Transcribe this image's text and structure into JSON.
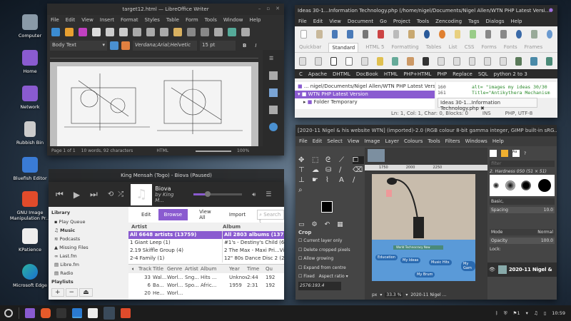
{
  "desktop": {
    "icons": [
      {
        "label": "Computer",
        "icon": "computer-icon",
        "color": "#9aa"
      },
      {
        "label": "Home",
        "icon": "home-folder-icon",
        "color": "#8a5bd0"
      },
      {
        "label": "Network",
        "icon": "network-folder-icon",
        "color": "#8a5bd0"
      },
      {
        "label": "Rubbish Bin",
        "icon": "trash-icon",
        "color": "#ccc"
      },
      {
        "label": "Bluefish Editor",
        "icon": "bluefish-icon",
        "color": "#3a7bd5"
      },
      {
        "label": "GNU Image Manipulation Pr...",
        "icon": "gimp-icon",
        "color": "#e04b2b"
      },
      {
        "label": "KPatience",
        "icon": "cards-icon",
        "color": "#eee"
      },
      {
        "label": "Microsoft Edge",
        "icon": "edge-icon",
        "color": "#2bb3a0"
      }
    ]
  },
  "writer": {
    "title": "target12.html — LibreOffice Writer",
    "menu": [
      "File",
      "Edit",
      "View",
      "Insert",
      "Format",
      "Styles",
      "Table",
      "Form",
      "Tools",
      "Window",
      "Help"
    ],
    "style": "Body Text",
    "font": "Verdana;Arial;Helvetic",
    "size": "15 pt",
    "status": {
      "page": "Page 1 of 1",
      "words": "10 words, 92 characters",
      "mode": "HTML",
      "zoom": "100%"
    }
  },
  "bluefish": {
    "title": "Ideas 30-1...Information Technology.php (/home/nigel/Documents/Nigel Allen/WTN PHP Latest Versi...",
    "menu": [
      "File",
      "Edit",
      "View",
      "Document",
      "Go",
      "Project",
      "Tools",
      "Zencoding",
      "Tags",
      "Dialogs",
      "Help"
    ],
    "tabs": [
      "Quickbar",
      "Standard",
      "HTML 5",
      "Formatting",
      "Tables",
      "List",
      "CSS",
      "Forms",
      "Fonts",
      "Frames"
    ],
    "active_tab": "Standard",
    "bar": [
      "C",
      "Apache",
      "DHTML",
      "DocBook",
      "HTML",
      "PHP+HTML",
      "PHP",
      "Replace",
      "SQL",
      "python 2 to 3"
    ],
    "path": "... nigel/Documents/Nigel Allen/WTN PHP Latest Version",
    "tree": [
      "WTN PHP Latest Version",
      "Folder Temporary"
    ],
    "lines": [
      {
        "n": "160",
        "code": "alt= \"images my ideas 30/30"
      },
      {
        "n": "161",
        "code": "Title=\"Antikythera Mechanism"
      }
    ],
    "doc_tab": "Ideas 30-1...Information Technology.php",
    "status": {
      "pos": "Ln: 1, Col: 1, Char: 0, Blocks: 0",
      "ins": "INS",
      "enc": "PHP, UTF-8"
    }
  },
  "music": {
    "title": "King Mensah (Togo) - Biova (Paused)",
    "track": "Biova",
    "artist": "by King M...",
    "library_label": "Library",
    "library": [
      "Play Queue",
      "Music",
      "Podcasts",
      "Missing Files",
      "Last.fm",
      "Libre.fm",
      "Radio"
    ],
    "playlists_label": "Playlists",
    "tabs": [
      "Edit",
      "Browse",
      "View All",
      "Import"
    ],
    "active_tab": "Browse",
    "search_placeholder": "Search t",
    "artist_header": "Artist",
    "album_header": "Album",
    "artists": [
      "All 6648 artists (13759)",
      "1 Giant Leep (1)",
      "2.19 Skiffle Group (4)",
      "2-4 Family (1)"
    ],
    "albums": [
      "All 2803 albums (13759)",
      "#1's - Destiny's Child (6)",
      "2 The Max - Maxi Pri...Virgin",
      "12\" 80s Dance Disc 2 (2)"
    ],
    "columns": [
      "Track",
      "Title",
      "Genre",
      "Artist",
      "Album",
      "Year",
      "Time",
      "Qu"
    ],
    "rows": [
      [
        "33",
        "Wal...",
        "Worl...",
        "Sng...",
        "Hits ...",
        "Unknown",
        "2:44",
        "192"
      ],
      [
        "6",
        "Ba...",
        "Worl...",
        "Spo...",
        "Afric...",
        "1959",
        "2:31",
        "192"
      ],
      [
        "20",
        "He...",
        "Worl...",
        "",
        "",
        "",
        "",
        ""
      ]
    ]
  },
  "gimp": {
    "title": "[2020-11 Nigel & his website WTN] (imported)-2.0 (RGB colour 8-bit gamma integer, GIMP built-in sRG...",
    "menu": [
      "File",
      "Edit",
      "Select",
      "View",
      "Image",
      "Layer",
      "Colours",
      "Tools",
      "Filters",
      "Windows",
      "Help"
    ],
    "tool_options": {
      "title": "Crop",
      "options": [
        "Current layer only",
        "Delete cropped pixels",
        "Allow growing",
        "Expand from centre"
      ],
      "fixed": "Fixed",
      "aspect": "Aspect ratio",
      "value": "2576:193.4"
    },
    "ruler": [
      "1750",
      "2000",
      "2250"
    ],
    "brushes": {
      "filter": "filter",
      "name": "2. Hardness 050 (51 × 51)",
      "preset": "Basic,",
      "spacing_label": "Spacing",
      "spacing": "10.0"
    },
    "layers": {
      "mode_label": "Mode",
      "mode": "Normal",
      "opacity_label": "Opacity",
      "opacity": "100.0",
      "lock_label": "Lock:",
      "layer": "2020-11 Nigel &"
    },
    "canvas_buttons": [
      "Education",
      "My Ideas",
      "Music Hits",
      "My Gam",
      "My Brum"
    ],
    "banner": "World Technocracy Now",
    "unit": "px",
    "zoom": "33.3 %",
    "status": "2020-11 Nigel ..."
  },
  "taskbar": {
    "apps": [
      "mint-menu-icon",
      "files-icon",
      "firefox-icon",
      "terminal-icon",
      "writer-icon",
      "rhythmbox-icon",
      "bluefish-icon",
      "gimp-icon"
    ],
    "battery_count": "1",
    "clock": "10:59"
  }
}
